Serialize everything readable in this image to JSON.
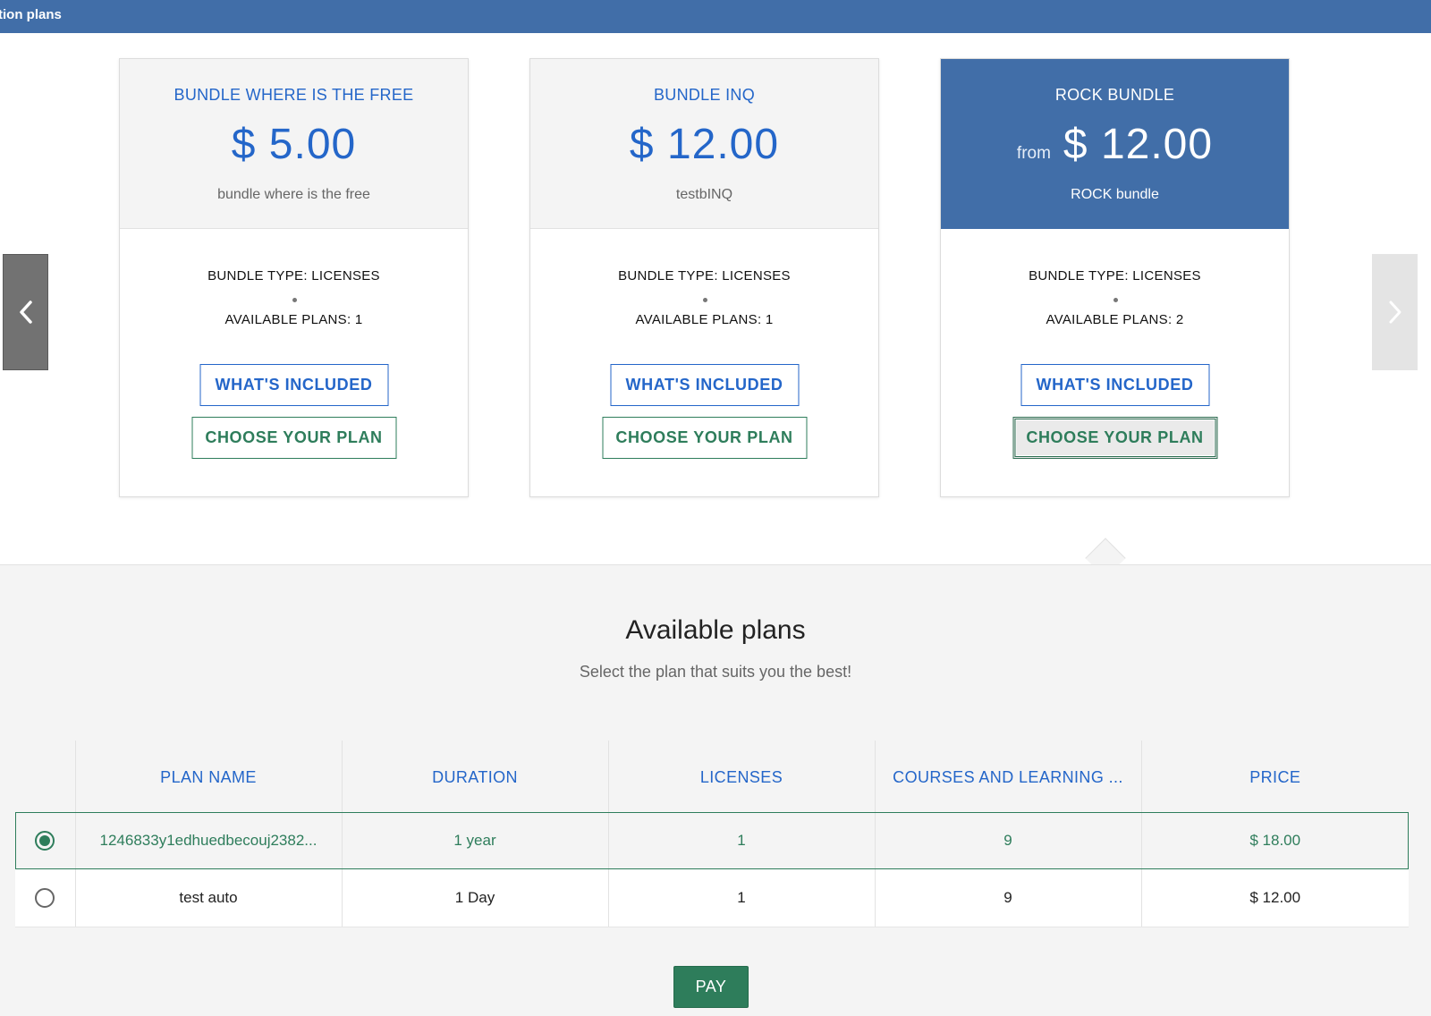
{
  "header": {
    "title": "tion plans"
  },
  "carousel": {
    "prev_icon": "chevron-left-icon",
    "next_icon": "chevron-right-icon"
  },
  "cards": [
    {
      "title": "BUNDLE WHERE IS THE FREE",
      "price_prefix": "",
      "price": "$ 5.00",
      "description": "bundle where is the free",
      "bundle_type": "BUNDLE TYPE: LICENSES",
      "available_plans": "AVAILABLE PLANS: 1",
      "included_label": "WHAT'S INCLUDED",
      "choose_label": "CHOOSE YOUR PLAN"
    },
    {
      "title": "BUNDLE INQ",
      "price_prefix": "",
      "price": "$ 12.00",
      "description": "testbINQ",
      "bundle_type": "BUNDLE TYPE: LICENSES",
      "available_plans": "AVAILABLE PLANS: 1",
      "included_label": "WHAT'S INCLUDED",
      "choose_label": "CHOOSE YOUR PLAN"
    },
    {
      "title": "ROCK BUNDLE",
      "price_prefix": "from",
      "price": "$ 12.00",
      "description": "ROCK bundle",
      "bundle_type": "BUNDLE TYPE: LICENSES",
      "available_plans": "AVAILABLE PLANS: 2",
      "included_label": "WHAT'S INCLUDED",
      "choose_label": "CHOOSE YOUR PLAN"
    }
  ],
  "plans": {
    "title": "Available plans",
    "subtitle": "Select the plan that suits you the best!",
    "columns": [
      "PLAN NAME",
      "DURATION",
      "LICENSES",
      "COURSES AND LEARNING ...",
      "PRICE"
    ],
    "rows": [
      {
        "selected": true,
        "name": "1246833y1edhuedbecouj2382...",
        "duration": "1 year",
        "licenses": "1",
        "courses": "9",
        "price": "$ 18.00"
      },
      {
        "selected": false,
        "name": "test auto",
        "duration": "1 Day",
        "licenses": "1",
        "courses": "9",
        "price": "$ 12.00"
      }
    ],
    "pay_label": "PAY"
  },
  "colors": {
    "brand": "#416ea8",
    "link_blue": "#2466c9",
    "accent_green": "#2e7d5b",
    "panel_gray": "#f4f4f4"
  }
}
